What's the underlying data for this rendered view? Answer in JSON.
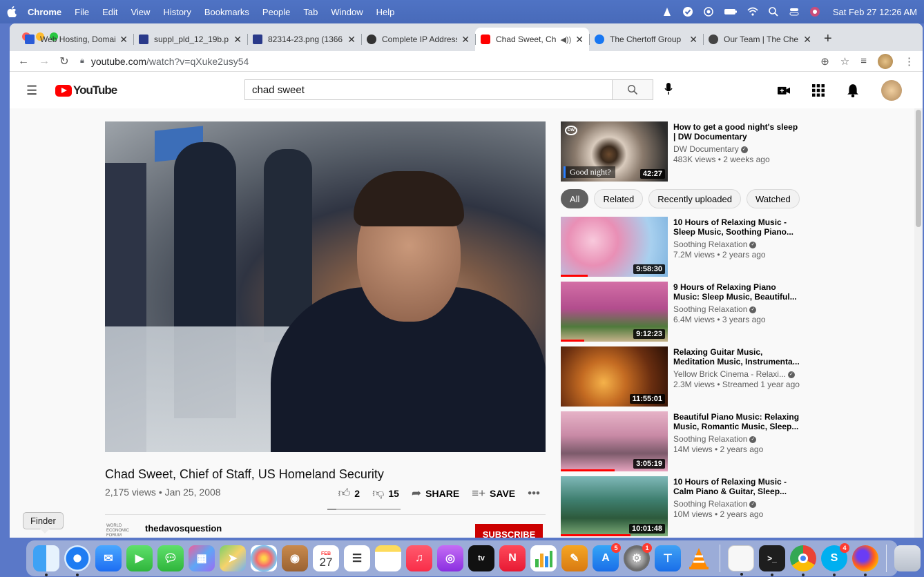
{
  "menubar": {
    "app": "Chrome",
    "items": [
      "File",
      "Edit",
      "View",
      "History",
      "Bookmarks",
      "People",
      "Tab",
      "Window",
      "Help"
    ],
    "clock": "Sat Feb 27  12:26 AM"
  },
  "tabs": [
    {
      "title": "Web Hosting, Domai",
      "favicon_color": "#2a5bd7"
    },
    {
      "title": "suppl_pld_12_19b.p",
      "favicon_color": "#2a3a8a"
    },
    {
      "title": "82314-23.png (1366",
      "favicon_color": "#2a3a8a"
    },
    {
      "title": "Complete IP Address",
      "favicon_color": "#333333"
    },
    {
      "title": "Chad Sweet, Ch",
      "favicon_color": "#ff0000",
      "active": true
    },
    {
      "title": "The Chertoff Group",
      "favicon_color": "#1877f2"
    },
    {
      "title": "Our Team | The Che",
      "favicon_color": "#444444"
    }
  ],
  "address": {
    "domain": "youtube.com",
    "path": "/watch?v=qXuke2usy54"
  },
  "youtube": {
    "logo": "YouTube",
    "search_value": "chad sweet"
  },
  "video": {
    "title": "Chad Sweet, Chief of Staff, US Homeland Security",
    "views_date": "2,175 views • Jan 25, 2008",
    "likes": "2",
    "dislikes": "15",
    "like_ratio": 0.12,
    "share": "SHARE",
    "save": "SAVE",
    "more": "•••",
    "channel_logo": "WORLD ECONOMIC FORUM",
    "channel": "thedavosquestion",
    "subscribe": "SUBSCRIBE"
  },
  "sidebar": {
    "top": {
      "title": "How to get a good night's sleep | DW Documentary",
      "channel": "DW Documentary",
      "meta": "483K views • 2 weeks ago",
      "duration": "42:27",
      "overlay": "Good night?",
      "logo": "DW"
    },
    "chips": [
      "All",
      "Related",
      "Recently uploaded",
      "Watched"
    ],
    "recs": [
      {
        "title": "10 Hours of Relaxing Music - Sleep Music, Soothing Piano...",
        "channel": "Soothing Relaxation",
        "meta": "7.2M views • 2 years ago",
        "duration": "9:58:30",
        "progress": 0.25
      },
      {
        "title": "9 Hours of Relaxing Piano Music: Sleep Music, Beautiful...",
        "channel": "Soothing Relaxation",
        "meta": "6.4M views • 3 years ago",
        "duration": "9:12:23",
        "progress": 0.22
      },
      {
        "title": "Relaxing Guitar Music, Meditation Music, Instrumenta...",
        "channel": "Yellow Brick Cinema - Relaxi...",
        "meta": "2.3M views • Streamed 1 year ago",
        "duration": "11:55:01",
        "progress": 0.0
      },
      {
        "title": "Beautiful Piano Music: Relaxing Music, Romantic Music, Sleep...",
        "channel": "Soothing Relaxation",
        "meta": "14M views • 2 years ago",
        "duration": "3:05:19",
        "progress": 0.5
      },
      {
        "title": "10 Hours of Relaxing Music - Calm Piano & Guitar, Sleep...",
        "channel": "Soothing Relaxation",
        "meta": "10M views • 2 years ago",
        "duration": "10:01:48",
        "progress": 0.65
      }
    ]
  },
  "tooltip": "Finder",
  "dock": {
    "calendar_month": "FEB",
    "calendar_day": "27",
    "appletv_label": "tv",
    "badges": {
      "appstore": "5",
      "settings": "1",
      "skype": "4"
    }
  }
}
